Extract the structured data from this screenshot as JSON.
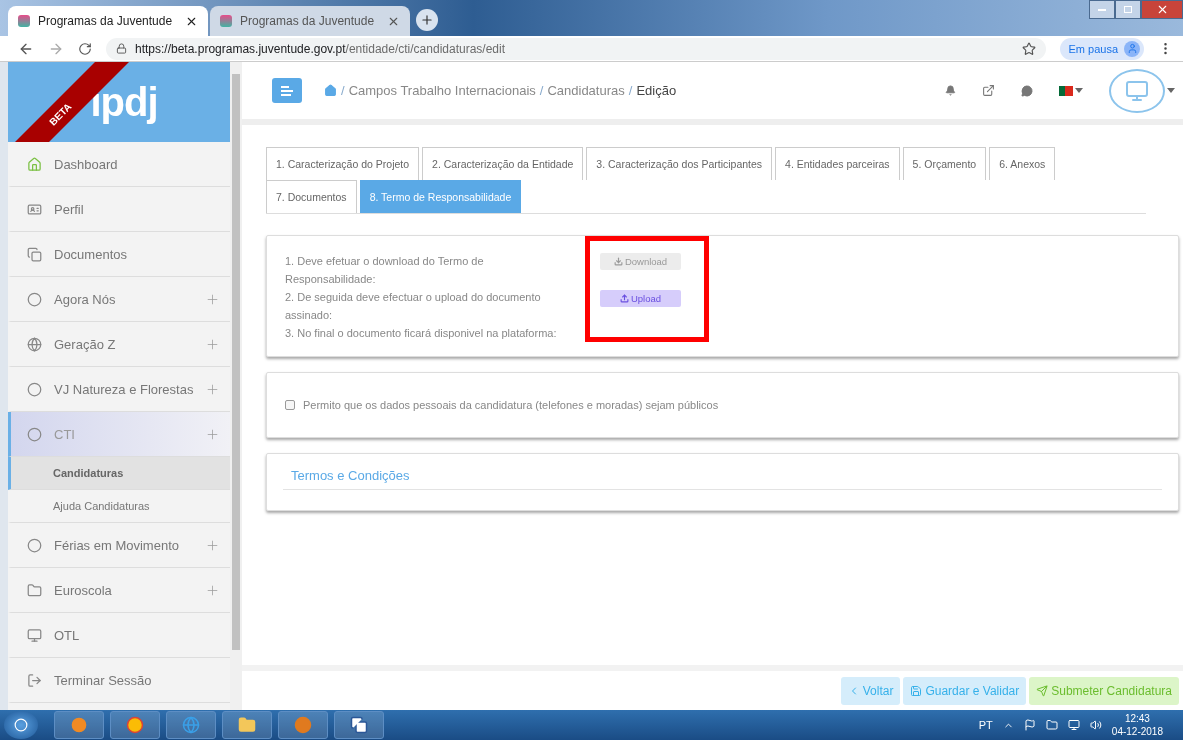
{
  "browser": {
    "tabs": [
      {
        "title": "Programas da Juventude",
        "selected": true
      },
      {
        "title": "Programas da Juventude",
        "selected": false
      }
    ],
    "url": {
      "host": "https://beta.programas.juventude.gov.pt",
      "path": "/entidade/cti/candidaturas/edit"
    },
    "profile_label": "Em pausa"
  },
  "sidebar": {
    "ribbon": "BETA",
    "logo": "ipdj",
    "items": [
      {
        "label": "Dashboard",
        "expandable": false,
        "expanded": false
      },
      {
        "label": "Perfil",
        "expandable": false,
        "expanded": false
      },
      {
        "label": "Documentos",
        "expandable": false,
        "expanded": false
      },
      {
        "label": "Agora Nós",
        "expandable": true,
        "expanded": false
      },
      {
        "label": "Geração Z",
        "expandable": true,
        "expanded": false
      },
      {
        "label": "VJ Natureza e Florestas",
        "expandable": true,
        "expanded": false
      },
      {
        "label": "CTI",
        "expandable": true,
        "expanded": true,
        "children": [
          {
            "label": "Candidaturas",
            "selected": true
          },
          {
            "label": "Ajuda Candidaturas",
            "selected": false
          }
        ]
      },
      {
        "label": "Férias em Movimento",
        "expandable": true,
        "expanded": false
      },
      {
        "label": "Euroscola",
        "expandable": true,
        "expanded": false
      },
      {
        "label": "OTL",
        "expandable": false,
        "expanded": false
      },
      {
        "label": "Terminar Sessão",
        "expandable": false,
        "expanded": false
      }
    ]
  },
  "header": {
    "separator": "/",
    "breadcrumb": [
      "Campos Trabalho Internacionais",
      "Candidaturas",
      "Edição"
    ]
  },
  "tabs": [
    {
      "label": "1. Caracterização do Projeto",
      "selected": false
    },
    {
      "label": "2. Caracterização da Entidade",
      "selected": false
    },
    {
      "label": "3. Caracterização dos Participantes",
      "selected": false
    },
    {
      "label": "4. Entidades parceiras",
      "selected": false
    },
    {
      "label": "5. Orçamento",
      "selected": false
    },
    {
      "label": "6. Anexos",
      "selected": false
    },
    {
      "label": "7. Documentos",
      "selected": false
    },
    {
      "label": "8. Termo de Responsabilidade",
      "selected": true
    }
  ],
  "instructions": [
    "1. Deve efetuar o download do Termo de Responsabilidade:",
    "2. De seguida deve efectuar o upload do documento assinado:",
    "3. No final o documento ficará disponivel na plataforma:"
  ],
  "actions_highlighted": true,
  "actions": [
    {
      "label": "Download",
      "kind": "download",
      "disabled": true
    },
    {
      "label": "Upload",
      "kind": "upload",
      "disabled": false
    }
  ],
  "consent": {
    "label": "Permito que os dados pessoais da candidatura (telefones e moradas) sejam públicos",
    "checked": false
  },
  "terms": {
    "title": "Termos e Condições"
  },
  "footer_buttons": [
    {
      "label": "Voltar",
      "kind": "back"
    },
    {
      "label": "Guardar e Validar",
      "kind": "save"
    },
    {
      "label": "Submeter Candidatura",
      "kind": "submit"
    }
  ],
  "taskbar": {
    "language": "PT",
    "time": "12:43",
    "date": "04-12-2018"
  }
}
